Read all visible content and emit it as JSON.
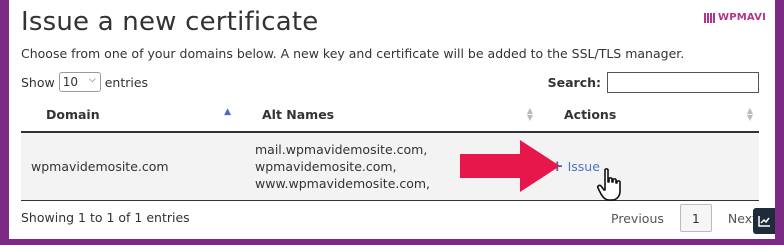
{
  "page": {
    "title": "Issue a new certificate",
    "description": "Choose from one of your domains below. A new key and certificate will be added to the SSL/TLS manager."
  },
  "brand": {
    "name": "WPMAVI",
    "color": "#b5338a"
  },
  "controls": {
    "show_label": "Show",
    "entries_value": "10",
    "entries_label": "entries",
    "search_label": "Search:",
    "search_value": ""
  },
  "table": {
    "columns": [
      {
        "label": "Domain",
        "sort": "ascending"
      },
      {
        "label": "Alt Names",
        "sort": "sortable"
      },
      {
        "label": "Actions",
        "sort": "sortable"
      }
    ],
    "rows": [
      {
        "domain": "wpmavidemosite.com",
        "alt_names": [
          "mail.wpmavidemosite.com,",
          "wpmavidemosite.com,",
          "www.wpmavidemosite.com,"
        ],
        "action_icon": "plus-icon",
        "action_label": "Issue"
      }
    ]
  },
  "footer": {
    "info": "Showing 1 to 1 of 1 entries",
    "previous": "Previous",
    "current_page": "1",
    "next": "Next"
  },
  "annotation": {
    "arrow_color": "#e8174b",
    "cursor": "hand-pointer-icon"
  },
  "colors": {
    "frame": "#7b2b83",
    "link": "#4a77c2"
  }
}
